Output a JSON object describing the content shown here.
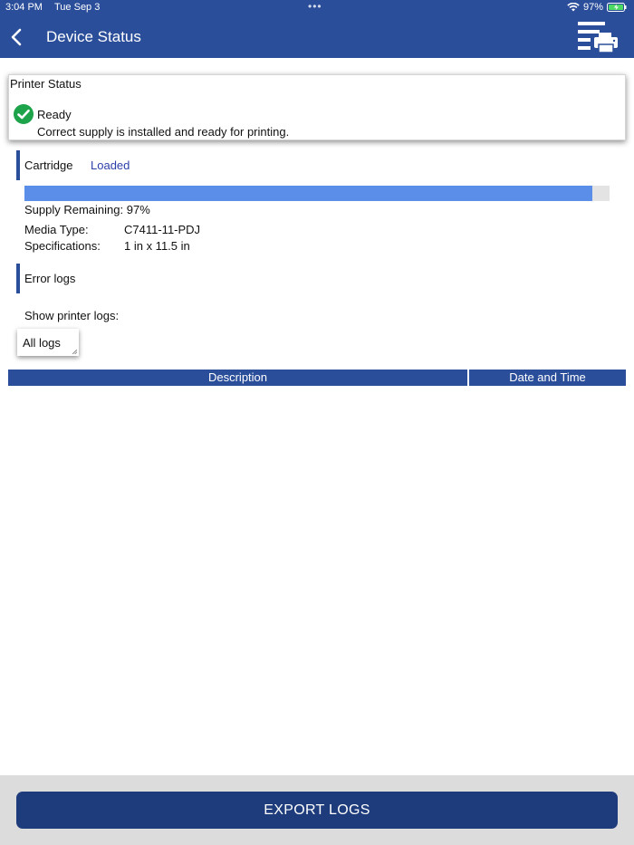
{
  "status_bar": {
    "time": "3:04 PM",
    "date": "Tue Sep 3",
    "dots": "•••",
    "battery": "97%"
  },
  "nav": {
    "title": "Device Status",
    "back_icon": "chevron-left-icon",
    "menu_icon": "printer-menu-icon"
  },
  "printer_status": {
    "title": "Printer Status",
    "state": "Ready",
    "description": "Correct supply is installed and ready for printing."
  },
  "cartridge": {
    "label": "Cartridge",
    "status": "Loaded",
    "supply_fraction": 0.97,
    "supply_text": "Supply Remaining: 97%",
    "media_type_label": "Media Type:",
    "media_type_value": "C7411-11-PDJ",
    "spec_label": "Specifications:",
    "spec_value": "1 in x 11.5 in"
  },
  "error_logs": {
    "label": "Error logs",
    "show_label": "Show printer logs:",
    "selected": "All logs",
    "columns": [
      "Description",
      "Date and Time"
    ]
  },
  "footer": {
    "export_label": "EXPORT LOGS"
  },
  "colors": {
    "primary": "#2b4e9a",
    "button": "#1e3c7c",
    "supply_fill": "#5b8ee8",
    "success": "#1da34a",
    "loaded_text": "#2c3fa8"
  }
}
